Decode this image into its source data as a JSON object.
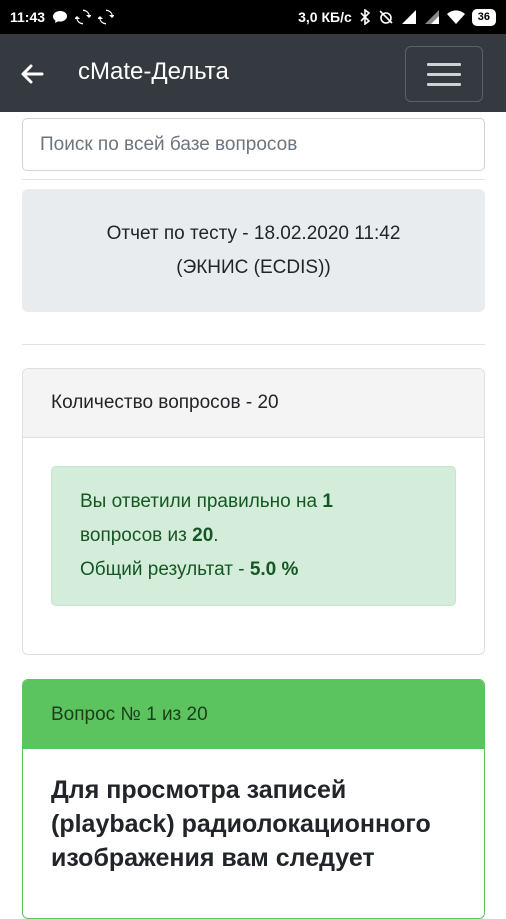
{
  "status_bar": {
    "time": "11:43",
    "speed": "3,0 КБ/с",
    "battery": "36",
    "left_icons": [
      "message-icon",
      "sync-icon",
      "sync-icon"
    ],
    "right_icons": [
      "bluetooth-icon",
      "alarm-off-icon",
      "signal-icon",
      "signal-icon",
      "wifi-icon",
      "battery-icon"
    ]
  },
  "appbar": {
    "title": "cMate-Дельта",
    "back_icon": "arrow-left-icon",
    "menu_icon": "hamburger-menu-icon"
  },
  "search": {
    "placeholder": "Поиск по всей базе вопросов",
    "value": ""
  },
  "report": {
    "line1": "Отчет по тесту - 18.02.2020 11:42",
    "line2": "(ЭКНИС (ECDIS))"
  },
  "summary_card": {
    "header": "Количество вопросов - 20",
    "alert": {
      "part1": "Вы ответили правильно на ",
      "correct": "1",
      "part2": "вопросов из ",
      "total": "20",
      "part3": ".",
      "part4": "Общий результат - ",
      "percent": "5.0 %"
    }
  },
  "question_card": {
    "header": "Вопрос № 1 из 20",
    "text": "Для просмотра записей (playback) радиолокационного изображения вам следует"
  },
  "colors": {
    "statusbar": "#000000",
    "appbar": "#343a40",
    "success_header": "#5cc45f",
    "alert_bg": "#d4edda",
    "alert_text": "#155724"
  }
}
